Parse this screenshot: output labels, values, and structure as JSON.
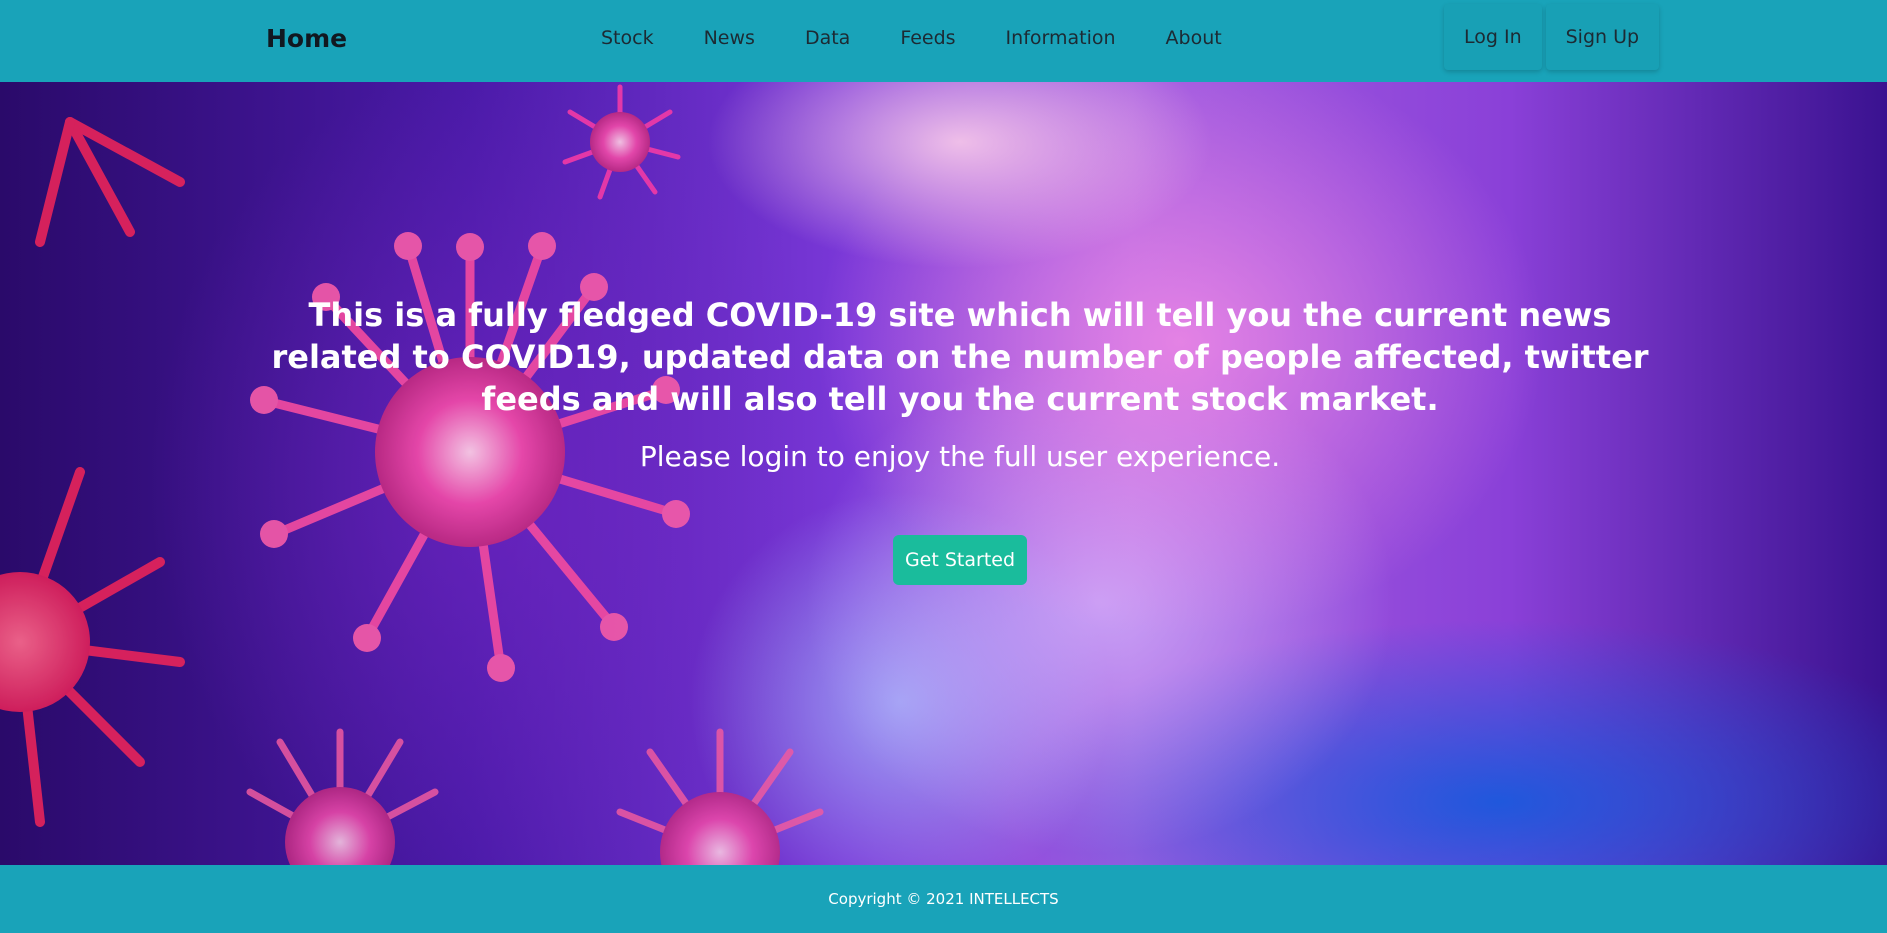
{
  "navbar": {
    "brand": "Home",
    "links": [
      "Stock",
      "News",
      "Data",
      "Feeds",
      "Information",
      "About"
    ],
    "login_label": "Log In",
    "signup_label": "Sign Up",
    "background_color": "#19a3b9"
  },
  "hero": {
    "headline": "This is a fully fledged COVID-19 site which will tell you the current news related to COVID19, updated data on the number of people affected, twitter feeds and will also tell you the current stock market.",
    "subheadline": "Please login to enjoy the full user experience.",
    "cta_label": "Get Started",
    "cta_color": "#1abc9c",
    "background_image": "coronavirus-illustration"
  },
  "footer": {
    "copyright": "Copyright © 2021 INTELLECTS"
  }
}
